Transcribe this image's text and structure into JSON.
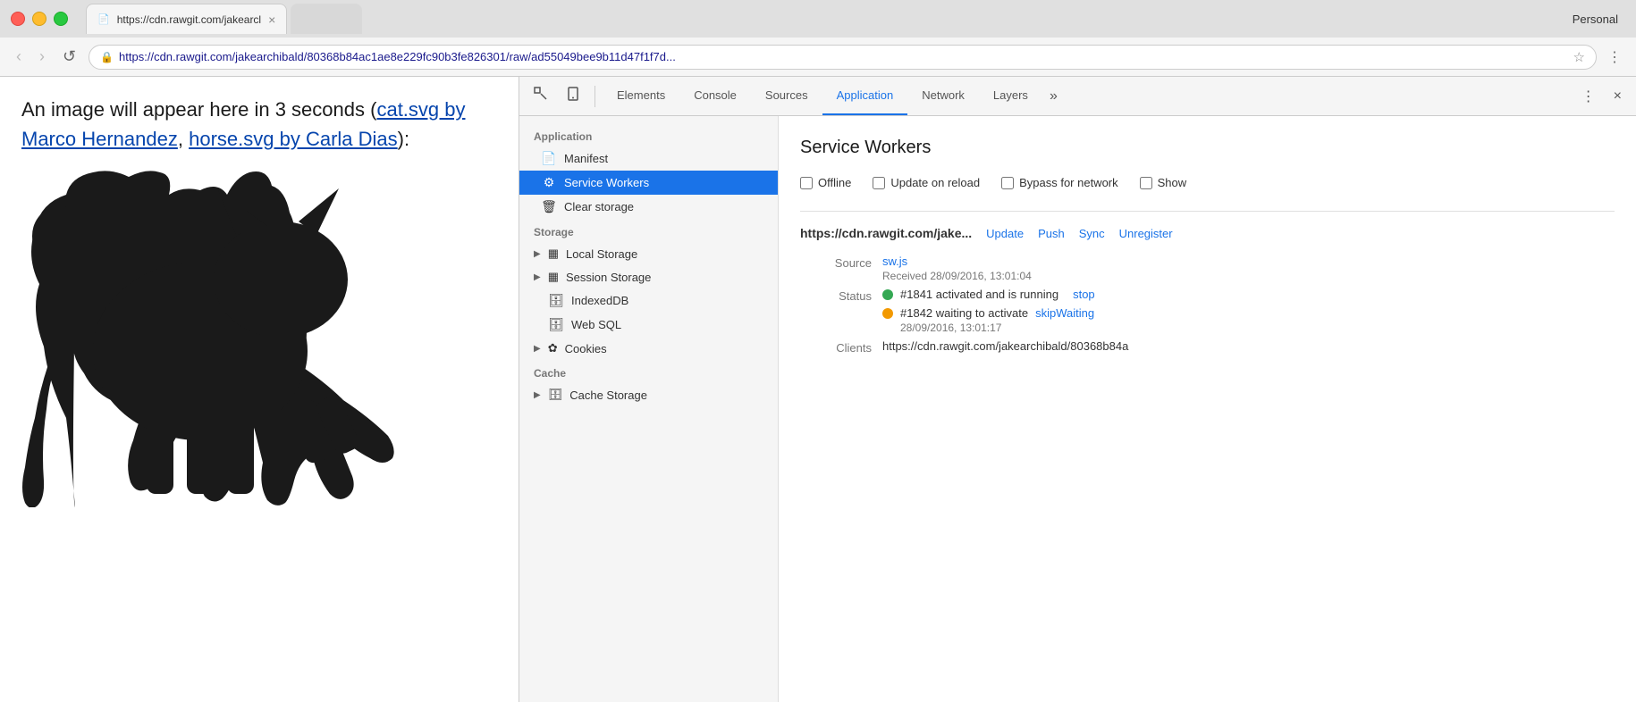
{
  "browser": {
    "profile": "Personal",
    "tab": {
      "favicon": "📄",
      "title": "https://cdn.rawgit.com/jakearcl",
      "close": "×"
    },
    "nav": {
      "back": "‹",
      "forward": "›",
      "reload": "↺",
      "url": "https://cdn.rawgit.com/jakearchibald/80368b84ac1ae8e229fc90b3fe826301/raw/ad55049bee9b11d47f1f7d...",
      "url_display": "https://cdn.rawgit.com/jakearchibald/80368b84ac1ae8e229fc90b3fe826301/raw/ad55049bee9b11d47f1f7d...",
      "more_options": "⋮"
    }
  },
  "page": {
    "intro_text": "An image will appear here in 3 seconds (",
    "link1_text": "cat.svg by Marco Hernandez",
    "separator": ", ",
    "link2_text": "horse.svg by Carla Dias",
    "outro_text": "):"
  },
  "devtools": {
    "toolbar": {
      "inspect_icon": "⬚",
      "device_icon": "⬛",
      "tabs": [
        "Elements",
        "Console",
        "Sources",
        "Application",
        "Network",
        "Layers"
      ],
      "active_tab": "Application",
      "more": "»",
      "options_icon": "⋮",
      "close_icon": "×"
    },
    "sidebar": {
      "app_section": "Application",
      "manifest_label": "Manifest",
      "service_workers_label": "Service Workers",
      "clear_storage_label": "Clear storage",
      "storage_section": "Storage",
      "local_storage_label": "Local Storage",
      "session_storage_label": "Session Storage",
      "indexeddb_label": "IndexedDB",
      "websql_label": "Web SQL",
      "cookies_label": "Cookies",
      "cache_section": "Cache",
      "cache_storage_label": "Cache Storage"
    },
    "main": {
      "panel_title": "Service Workers",
      "offline_label": "Offline",
      "update_on_reload_label": "Update on reload",
      "bypass_for_network_label": "Bypass for network",
      "show_label": "Show",
      "sw_url": "https://cdn.rawgit.com/jake...",
      "update_link": "Update",
      "push_link": "Push",
      "sync_link": "Sync",
      "unregister_link": "Unregister",
      "source_label": "Source",
      "source_file": "sw.js",
      "received_label": "Received",
      "received_value": "28/09/2016, 13:01:04",
      "status_label": "Status",
      "status1_text": "#1841 activated and is running",
      "status1_link": "stop",
      "status2_text": "#1842 waiting to activate",
      "status2_link": "skipWaiting",
      "waiting_time": "28/09/2016, 13:01:17",
      "clients_label": "Clients",
      "clients_value": "https://cdn.rawgit.com/jakearchibald/80368b84a"
    }
  }
}
